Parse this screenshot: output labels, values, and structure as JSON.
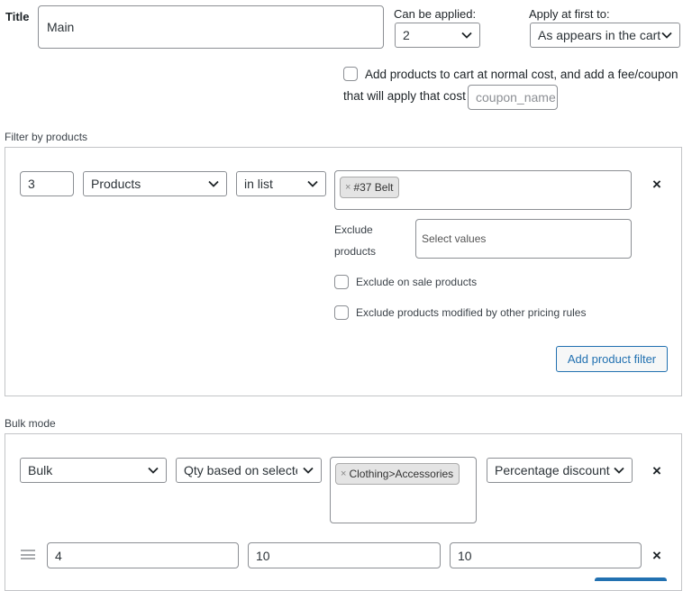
{
  "rule": {
    "title_label": "Title",
    "title_value": "Main",
    "can_be_applied_label": "Can be applied:",
    "can_be_applied_value": "2",
    "apply_first_label": "Apply at first to:",
    "apply_first_value": "As appears in the cart",
    "normal_cost_text_1": "Add products to cart at normal cost, and add a fee/coupon",
    "normal_cost_text_2": "that will apply that cost",
    "coupon_placeholder": "coupon_name"
  },
  "filter": {
    "section_label": "Filter by products",
    "qty_value": "3",
    "type_value": "Products",
    "method_value": "in list",
    "selected_tag": "#37 Belt",
    "tag_remove": "×",
    "exclude_label_1": "Exclude",
    "exclude_label_2": "products",
    "exclude_placeholder": "Select values",
    "exclude_on_sale": "Exclude on sale products",
    "exclude_modified": "Exclude products modified by other pricing rules",
    "add_filter_button": "Add product filter",
    "remove_icon": "×"
  },
  "bulk": {
    "section_label": "Bulk mode",
    "mode_value": "Bulk",
    "qty_based_value": "Qty based on selected categories",
    "category_tag": "Clothing>Accessories",
    "tag_remove": "×",
    "discount_type_value": "Percentage discount",
    "remove_icon": "×",
    "range": {
      "from": "4",
      "to": "10",
      "discount": "10",
      "remove_icon": "×"
    }
  },
  "colors": {
    "accent": "#2271b1",
    "border": "#8c8f94",
    "panel_border": "#c3c4c7"
  }
}
